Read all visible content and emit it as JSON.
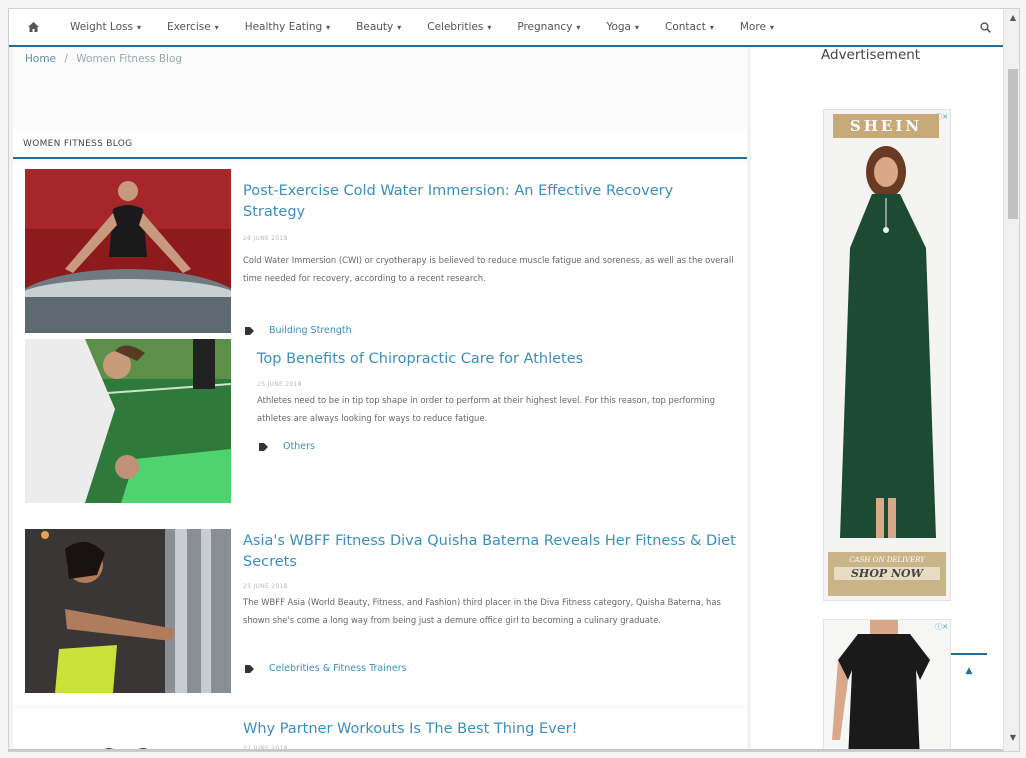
{
  "nav": {
    "items": [
      {
        "label": "Weight Loss",
        "caret": "▾"
      },
      {
        "label": "Exercise",
        "caret": "▾"
      },
      {
        "label": "Healthy Eating",
        "caret": "▾"
      },
      {
        "label": "Beauty",
        "caret": "▾"
      },
      {
        "label": "Celebrities",
        "caret": "▾"
      },
      {
        "label": "Pregnancy",
        "caret": "▾"
      },
      {
        "label": "Yoga",
        "caret": "▾"
      },
      {
        "label": "Contact",
        "caret": "▾"
      },
      {
        "label": "More",
        "caret": "▾"
      }
    ],
    "home_icon": "home-icon",
    "search_icon": "search-icon"
  },
  "breadcrumb": {
    "home": "Home",
    "separator": "/",
    "current": "Women Fitness Blog"
  },
  "section": {
    "title": "WOMEN FITNESS BLOG"
  },
  "posts": [
    {
      "title": "Post-Exercise Cold Water Immersion: An Effective Recovery Strategy",
      "date": "28 JUNE 2018",
      "excerpt": "Cold Water Immersion (CWI) or cryotherapy is believed to reduce muscle fatigue and soreness, as well as the overall time needed for recovery, according to a recent research.",
      "tag": "Building Strength"
    },
    {
      "title": "Top Benefits of Chiropractic Care for Athletes",
      "date": "25 JUNE 2018",
      "excerpt": "Athletes need to be in tip top shape in order to perform at their highest level. For this reason, top performing athletes are always looking for ways to reduce fatigue.",
      "tag": "Others"
    },
    {
      "title": "Asia's WBFF Fitness Diva Quisha Baterna Reveals Her Fitness & Diet Secrets",
      "date": "25 JUNE 2018",
      "excerpt": "The WBFF Asia (World Beauty, Fitness, and Fashion) third placer in the Diva Fitness category, Quisha Baterna, has shown she's come a long way from being just a demure office girl to becoming a culinary graduate.",
      "tag": "Celebrities & Fitness Trainers"
    },
    {
      "title": "Why Partner Workouts Is The Best Thing Ever!",
      "date": "22 JUNE 2018"
    }
  ],
  "sidebar": {
    "ad_title": "Advertisement",
    "ad_badge": "ⓘ✕",
    "brand": "SHEIN",
    "cod_line1": "CASH ON DELIVERY",
    "cod_line2": "SHOP NOW",
    "ad2_badge": "ⓘ✕",
    "back_to_top": "▲"
  },
  "colors": {
    "accent": "#1f6f98",
    "link": "#3a8fc0",
    "dress": "#1d4a33"
  }
}
